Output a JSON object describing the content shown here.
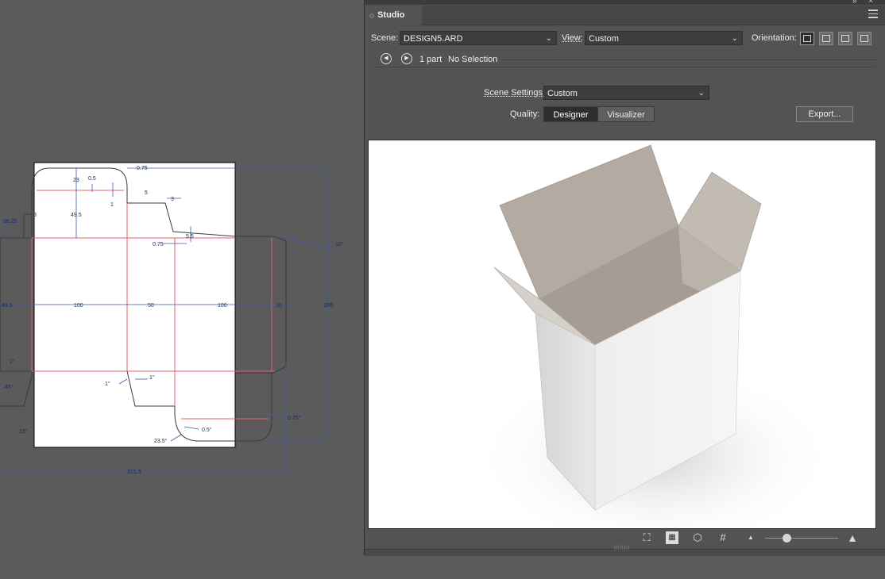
{
  "canvas": {
    "dimensions": {
      "d23": "23",
      "d05a": "0.5",
      "d1": "1",
      "d075a": "0.75",
      "d5": "5",
      "d3": "3",
      "d495a": "49.5",
      "d3625": "36.25",
      "d8": "8",
      "d55": "5.5",
      "d075b": "0.75",
      "d10deg": "10°",
      "d495b": "49.5",
      "d100a": "100",
      "d50": "50",
      "d100b": "100",
      "d16": "16",
      "d285": "285",
      "d2deg": "2°",
      "d45deg": "45°",
      "d1deg_a": "1°",
      "d1deg_b": "1°",
      "d13deg": "13°",
      "d075deg": "0.75°",
      "d05deg": "0.5°",
      "d235": "23.5°",
      "d3155": "315.5"
    }
  },
  "panel": {
    "tab_title": "Studio",
    "window_controls": "» ×",
    "scene_label": "Scene:",
    "scene_value": "DESIGN5.ARD",
    "view_label": "View:",
    "view_value": "Custom",
    "orientation_label": "Orientation:",
    "parts": "1 part",
    "selection": "No Selection",
    "scene_settings_label": "Scene Settings:",
    "scene_settings_value": "Custom",
    "quality_label": "Quality:",
    "quality_options": [
      "Designer",
      "Visualizer"
    ],
    "quality_selected": "Designer",
    "export_label": "Export...",
    "zoom_level": 0.3
  },
  "icons": {
    "prev": "◀",
    "next": "▶",
    "dropdown": "⌄",
    "fit": "⛶",
    "render": "▦",
    "box": "⬡",
    "grid": "#",
    "zoom_out": "▲",
    "zoom_in": "▲"
  }
}
